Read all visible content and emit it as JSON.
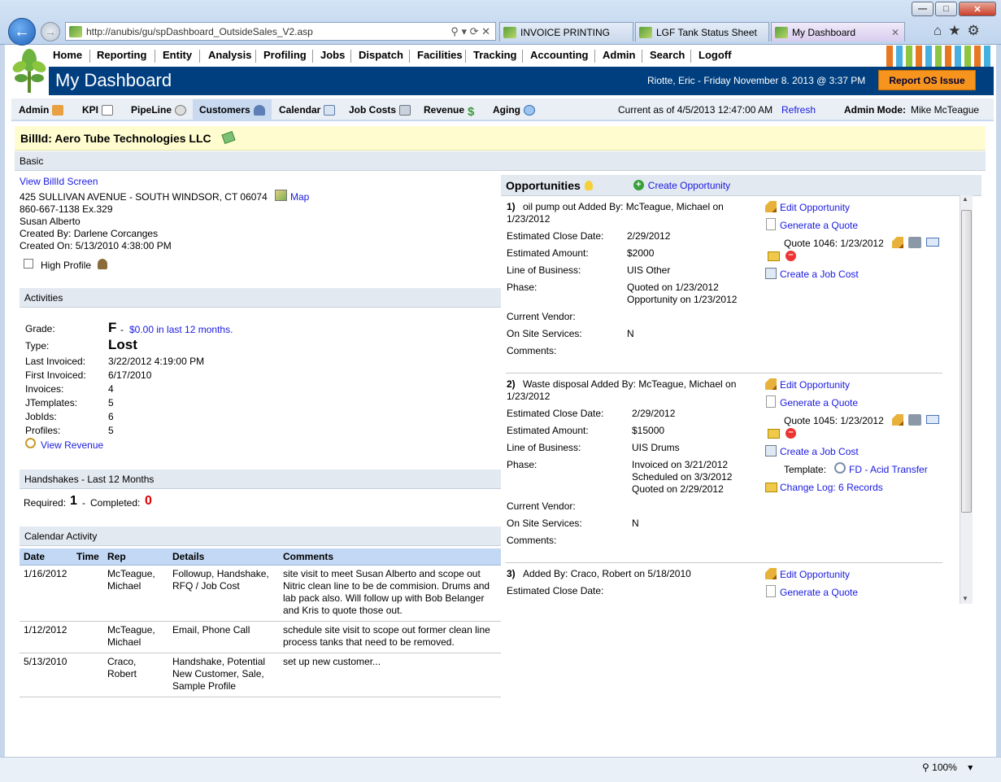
{
  "browser": {
    "url": "http://anubis/gu/spDashboard_OutsideSales_V2.asp",
    "tabs": [
      {
        "label": "INVOICE PRINTING"
      },
      {
        "label": "LGF Tank Status Sheet"
      },
      {
        "label": "My Dashboard"
      }
    ],
    "zoom": "100%"
  },
  "menu": [
    "Home",
    "Reporting",
    "Entity",
    "Analysis",
    "Profiling",
    "Jobs",
    "Dispatch",
    "Facilities",
    "Tracking",
    "Accounting",
    "Admin",
    "Search",
    "Logoff"
  ],
  "header": {
    "title": "My Dashboard",
    "user_date": "Riotte, Eric - Friday November 8. 2013 @ 3:37 PM",
    "report_button": "Report OS Issue"
  },
  "subnav": {
    "items": [
      "Admin",
      "KPI",
      "PipeLine",
      "Customers",
      "Calendar",
      "Job Costs",
      "Revenue",
      "Aging"
    ],
    "current_as_of": "Current as of 4/5/2013 12:47:00 AM",
    "refresh": "Refresh",
    "admin_mode_label": "Admin Mode:",
    "admin_mode_value": "Mike McTeague"
  },
  "bill": {
    "title": "BillId: Aero Tube Technologies LLC",
    "basic_label": "Basic",
    "view_link": "View BillId Screen",
    "address": "425 SULLIVAN AVENUE - SOUTH WINDSOR, CT 06074",
    "map_link": "Map",
    "phone": "860-667-1138 Ex.329",
    "contact": "Susan Alberto",
    "created_by": "Created By: Darlene Corcanges",
    "created_on": "Created On: 5/13/2010 4:38:00 PM",
    "high_profile": "High Profile"
  },
  "activities": {
    "title": "Activities",
    "grade_label": "Grade:",
    "grade_value": "F",
    "grade_dash": "-",
    "grade_link": "$0.00 in last 12 months.",
    "type_label": "Type:",
    "type_value": "Lost",
    "rows": [
      {
        "label": "Last Invoiced:",
        "value": "3/22/2012 4:19:00 PM"
      },
      {
        "label": "First Invoiced:",
        "value": "6/17/2010"
      },
      {
        "label": "Invoices:",
        "value": "4"
      },
      {
        "label": "JTemplates:",
        "value": "5"
      },
      {
        "label": "JobIds:",
        "value": "6"
      },
      {
        "label": "Profiles:",
        "value": "5"
      }
    ],
    "view_revenue": "View Revenue"
  },
  "handshakes": {
    "title": "Handshakes - Last 12 Months",
    "required_label": "Required:",
    "required_value": "1",
    "dash": "-",
    "completed_label": "Completed:",
    "completed_value": "0"
  },
  "calendar": {
    "title": "Calendar Activity",
    "columns": [
      "Date",
      "Time",
      "Rep",
      "Details",
      "Comments"
    ],
    "rows": [
      {
        "date": "1/16/2012",
        "time": "",
        "rep": "McTeague, Michael",
        "details": "Followup, Handshake, RFQ / Job Cost",
        "comments": "site visit to meet Susan Alberto and scope out Nitric clean line to be de commision. Drums and lab pack also. Will follow up with Bob Belanger and Kris to quote those out."
      },
      {
        "date": "1/12/2012",
        "time": "",
        "rep": "McTeague, Michael",
        "details": "Email, Phone Call",
        "comments": "schedule site visit to scope out former clean line process tanks that need to be removed."
      },
      {
        "date": "5/13/2010",
        "time": "",
        "rep": "Craco, Robert",
        "details": "Handshake, Potential New Customer, Sale, Sample Profile",
        "comments": "set up new customer..."
      }
    ]
  },
  "opportunities": {
    "title": "Opportunities",
    "create": "Create Opportunity",
    "labels": {
      "close": "Estimated Close Date:",
      "amount": "Estimated Amount:",
      "lob": "Line of Business:",
      "phase": "Phase:",
      "vendor": "Current Vendor:",
      "onsite": "On Site Services:",
      "comments": "Comments:"
    },
    "actions": {
      "edit": "Edit Opportunity",
      "quote": "Generate a Quote",
      "jobcost": "Create a Job Cost"
    },
    "items": [
      {
        "num": "1)",
        "head1": "oil pump out Added By: McTeague, Michael on",
        "head2": "1/23/2012",
        "close": "2/29/2012",
        "amount": "$2000",
        "lob": "UIS Other",
        "phase1": "Quoted on 1/23/2012",
        "phase2": "Opportunity on 1/23/2012",
        "phase3": "",
        "onsite": "N",
        "quote": "Quote 1046: 1/23/2012"
      },
      {
        "num": "2)",
        "head1": "Waste disposal Added By: McTeague, Michael on",
        "head2": "1/23/2012",
        "close": "2/29/2012",
        "amount": "$15000",
        "lob": "UIS Drums",
        "phase1": "Invoiced on 3/21/2012",
        "phase2": "Scheduled on 3/3/2012",
        "phase3": "Quoted on 2/29/2012",
        "onsite": "N",
        "quote": "Quote 1045: 1/23/2012",
        "template_label": "Template:",
        "template_link": "FD - Acid Transfer",
        "changelog": "Change Log: 6 Records"
      },
      {
        "num": "3)",
        "head1": "Added By: Craco, Robert on 5/18/2010",
        "head2": ""
      }
    ]
  }
}
